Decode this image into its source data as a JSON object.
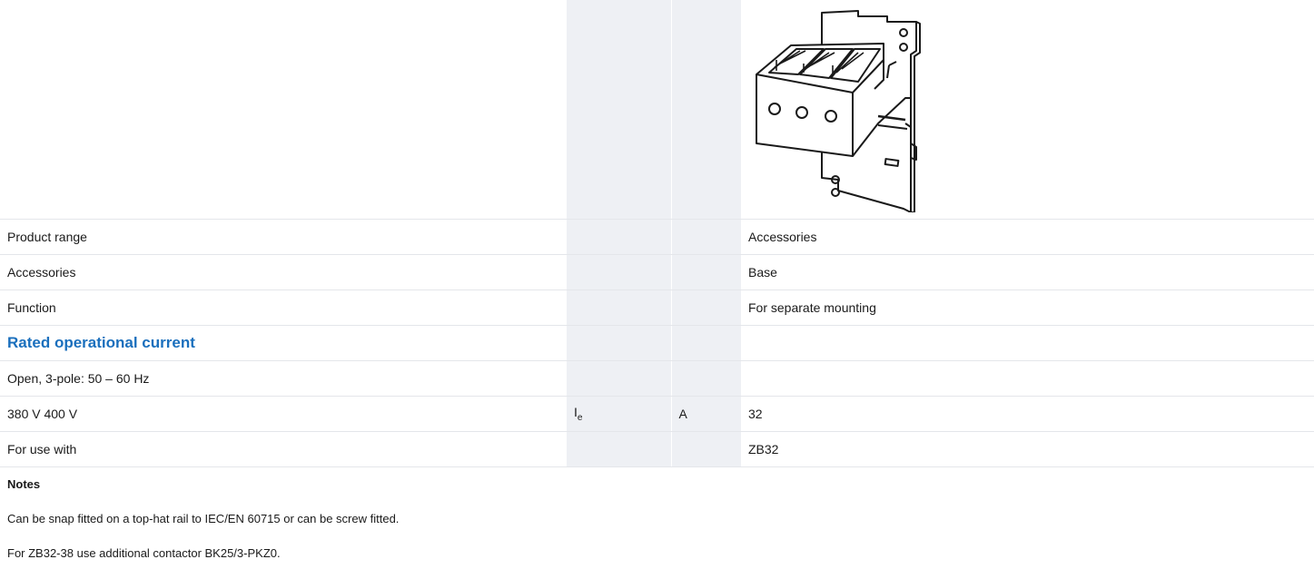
{
  "rows": {
    "product_range": {
      "label": "Product range",
      "value": "Accessories"
    },
    "accessories": {
      "label": "Accessories",
      "value": "Base"
    },
    "function": {
      "label": "Function",
      "value": "For separate mounting"
    },
    "rated_heading": {
      "label": "Rated operational current"
    },
    "open_3pole": {
      "label": "Open, 3-pole: 50 – 60 Hz"
    },
    "voltage": {
      "label": "380 V 400 V",
      "symbol_main": "I",
      "symbol_sub": "e",
      "unit": "A",
      "value": "32"
    },
    "for_use_with": {
      "label": "For use with",
      "value": "ZB32"
    }
  },
  "notes": {
    "title": "Notes",
    "lines": [
      "Can be snap fitted on a top-hat rail to IEC/EN 60715 or can be screw fitted.",
      "For ZB32-38 use additional contactor BK25/3-PKZ0."
    ]
  },
  "image": {
    "icon": "product-base-drawing-icon"
  }
}
